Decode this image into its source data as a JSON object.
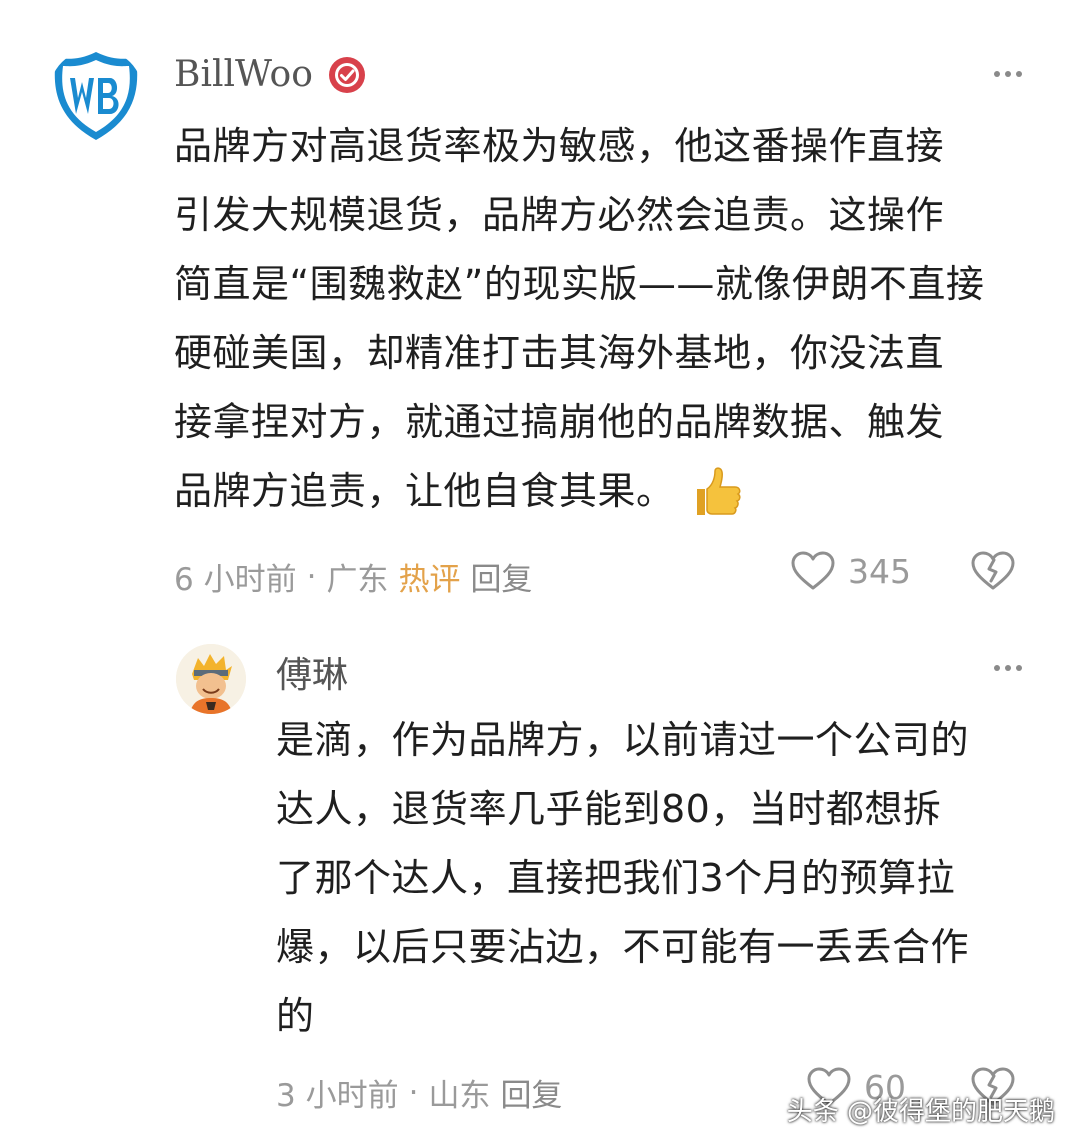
{
  "comments": [
    {
      "username": "BillWoo",
      "verified_icon": "verified-badge-icon",
      "text_lines": [
        "品牌方对高退货率极为敏感，他这番操作直接",
        "引发大规模退货，品牌方必然会追责。这操作",
        "简直是“围魏救赵”的现实版——就像伊朗不直接",
        "硬碰美国，却精准打击其海外基地，你没法直",
        "接拿捏对方，就通过搞崩他的品牌数据、触发",
        "品牌方追责，让他自食其果。"
      ],
      "emoji": "👍",
      "time": "6 小时前",
      "separator": "·",
      "location": "广东",
      "hot_label": "热评",
      "reply_label": "回复",
      "likes": "345"
    },
    {
      "username": "傅琳",
      "text_lines": [
        "是滴，作为品牌方，以前请过一个公司的",
        "达人，退货率几乎能到80，当时都想拆",
        "了那个达人，直接把我们3个月的预算拉",
        "爆，以后只要沾边，不可能有一丢丢合作",
        "的"
      ],
      "time": "3 小时前",
      "separator": "·",
      "location": "山东",
      "reply_label": "回复",
      "likes": "60"
    }
  ],
  "watermark": "头条 @彼得堡的肥天鹅",
  "colors": {
    "hot": "#e3a24a",
    "wb_blue": "#1a8bd0",
    "verified_red": "#d8414b"
  }
}
